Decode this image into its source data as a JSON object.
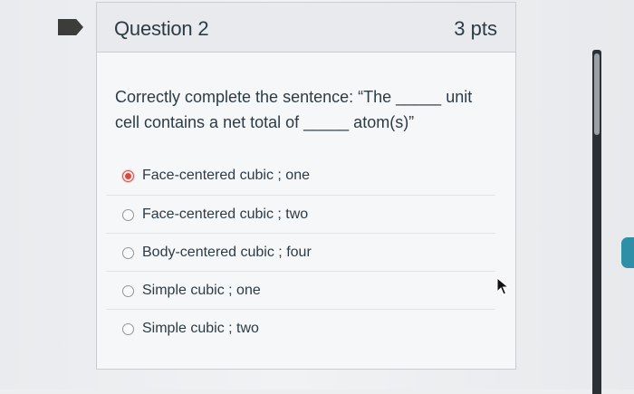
{
  "question": {
    "title": "Question 2",
    "points": "3 pts",
    "text_line1": "Correctly complete the sentence: “The _____ unit",
    "text_line2": "cell contains a net total of _____ atom(s)”"
  },
  "answers": [
    {
      "label": "Face-centered cubic ; one",
      "selected": true
    },
    {
      "label": "Face-centered cubic ; two",
      "selected": false
    },
    {
      "label": "Body-centered cubic ; four",
      "selected": false
    },
    {
      "label": "Simple cubic ; one",
      "selected": false
    },
    {
      "label": "Simple cubic ; two",
      "selected": false
    }
  ],
  "icons": {
    "bookmark": "bookmark-icon",
    "cursor": "mouse-pointer-icon",
    "side_tab": "side-panel-tab-icon"
  },
  "colors": {
    "text": "#2d3b45",
    "selected_radio": "#d9473f",
    "header_bg": "#e8eaed",
    "side_tab": "#2f8fa6"
  }
}
